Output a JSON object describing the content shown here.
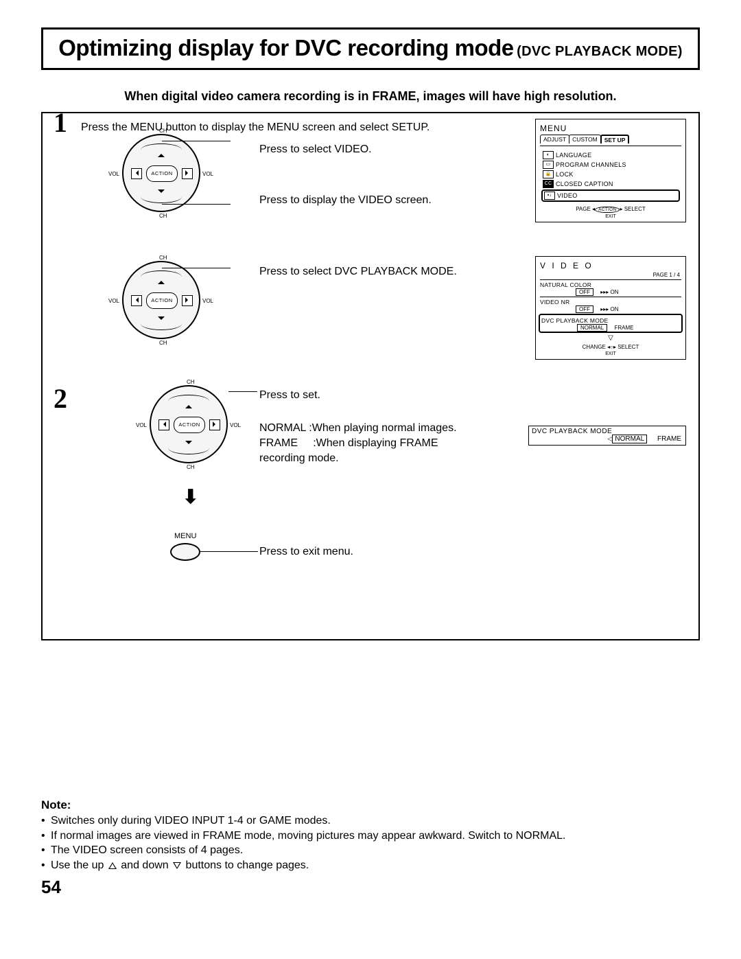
{
  "title": {
    "main": "Optimizing display for DVC recording mode",
    "sub": "(DVC PLAYBACK MODE)"
  },
  "intro": "When digital video camera recording is in FRAME, images will have high resolution.",
  "steps": {
    "s1": {
      "num": "1",
      "line": "Press the MENU button to display the MENU screen and select SETUP.",
      "a": "Press to select VIDEO.",
      "b": "Press to display the VIDEO screen.",
      "c": "Press to select DVC PLAYBACK MODE."
    },
    "s2": {
      "num": "2",
      "set": "Press to set.",
      "normal": "NORMAL :When playing normal images.",
      "frame1": "FRAME",
      "frame2": ":When displaying FRAME",
      "frame3": "recording mode.",
      "exit_label": "MENU",
      "exit": "Press to exit menu."
    }
  },
  "dial": {
    "action": "ACTION",
    "ch": "CH",
    "vol": "VOL"
  },
  "osd_menu": {
    "title": "MENU",
    "tabs": {
      "adjust": "ADJUST",
      "custom": "CUSTOM",
      "setup": "SET  UP"
    },
    "items": {
      "language": "LANGUAGE",
      "program": "PROGRAM  CHANNELS",
      "lock": "LOCK",
      "cc": "CLOSED  CAPTION",
      "cc_icon": "CC",
      "video": "VIDEO"
    },
    "footer": {
      "page": "PAGE",
      "action": "ACTION",
      "select": "SELECT",
      "exit": "EXIT"
    }
  },
  "osd_video": {
    "title": "V I D E O",
    "page": "PAGE 1 / 4",
    "rows": {
      "natural": "NATURAL  COLOR",
      "off": "OFF",
      "on": "ON",
      "nr": "VIDEO  NR",
      "dvc": "DVC  PLAYBACK  MODE",
      "normal": "NORMAL",
      "frame": "FRAME"
    },
    "footer": {
      "change": "CHANGE",
      "select": "SELECT",
      "exit": "EXIT"
    }
  },
  "osd_small": {
    "label": "DVC  PLAYBACK  MODE",
    "normal": "NORMAL",
    "frame": "FRAME"
  },
  "notes": {
    "heading": "Note:",
    "n1": "Switches only during VIDEO INPUT 1-4 or GAME modes.",
    "n2": "If normal images are viewed in FRAME mode, moving pictures may appear awkward. Switch to NORMAL.",
    "n3": "The VIDEO screen consists of 4 pages.",
    "n4a": "Use the up ",
    "n4b": " and down ",
    "n4c": " buttons to change pages."
  },
  "page_number": "54"
}
